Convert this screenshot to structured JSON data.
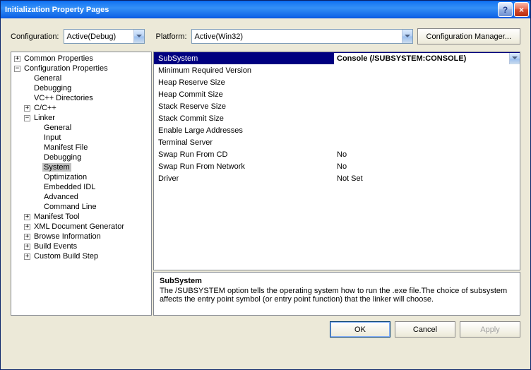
{
  "window": {
    "title": "Initialization Property Pages"
  },
  "top": {
    "config_label": "Configuration:",
    "config_value": "Active(Debug)",
    "platform_label": "Platform:",
    "platform_value": "Active(Win32)",
    "config_manager": "Configuration Manager..."
  },
  "tree": {
    "common": "Common Properties",
    "config_props": "Configuration Properties",
    "general": "General",
    "debugging": "Debugging",
    "vcdirs": "VC++ Directories",
    "cpp": "C/C++",
    "linker": "Linker",
    "linker_general": "General",
    "linker_input": "Input",
    "linker_manifest": "Manifest File",
    "linker_debugging": "Debugging",
    "linker_system": "System",
    "linker_optimization": "Optimization",
    "linker_embeddedidl": "Embedded IDL",
    "linker_advanced": "Advanced",
    "linker_cmdline": "Command Line",
    "manifest_tool": "Manifest Tool",
    "xml_gen": "XML Document Generator",
    "browse_info": "Browse Information",
    "build_events": "Build Events",
    "custom_build": "Custom Build Step"
  },
  "grid": {
    "subsystem": {
      "name": "SubSystem",
      "value": "Console (/SUBSYSTEM:CONSOLE)"
    },
    "min_req_ver": {
      "name": "Minimum Required Version",
      "value": ""
    },
    "heap_reserve": {
      "name": "Heap Reserve Size",
      "value": ""
    },
    "heap_commit": {
      "name": "Heap Commit Size",
      "value": ""
    },
    "stack_reserve": {
      "name": "Stack Reserve Size",
      "value": ""
    },
    "stack_commit": {
      "name": "Stack Commit Size",
      "value": ""
    },
    "large_addr": {
      "name": "Enable Large Addresses",
      "value": ""
    },
    "terminal_srv": {
      "name": "Terminal Server",
      "value": ""
    },
    "swap_cd": {
      "name": "Swap Run From CD",
      "value": "No"
    },
    "swap_net": {
      "name": "Swap Run From Network",
      "value": "No"
    },
    "driver": {
      "name": "Driver",
      "value": "Not Set"
    }
  },
  "desc": {
    "title": "SubSystem",
    "text": "The /SUBSYSTEM option tells the operating system how to run the .exe file.The choice of subsystem affects the entry point symbol (or entry point function) that the linker will choose."
  },
  "buttons": {
    "ok": "OK",
    "cancel": "Cancel",
    "apply": "Apply"
  }
}
